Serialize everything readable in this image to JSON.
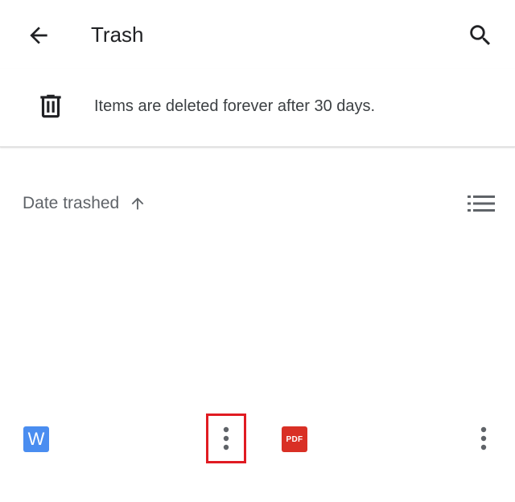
{
  "header": {
    "title": "Trash",
    "back_icon": "arrow-back-icon",
    "search_icon": "search-icon"
  },
  "banner": {
    "icon": "trash-can-icon",
    "message": "Items are deleted forever after 30 days."
  },
  "sort": {
    "label": "Date trashed",
    "direction_icon": "arrow-up-icon",
    "view_icon": "list-view-icon"
  },
  "files": [
    {
      "type": "word",
      "icon_letter": "W",
      "icon_color": "#4a8df0",
      "more_icon": "more-vert-icon",
      "highlighted": true
    },
    {
      "type": "pdf",
      "icon_text": "PDF",
      "icon_color": "#d93025",
      "more_icon": "more-vert-icon",
      "highlighted": false
    }
  ],
  "colors": {
    "highlight": "#e01b22",
    "text_primary": "#202124",
    "text_secondary": "#5f6368"
  }
}
